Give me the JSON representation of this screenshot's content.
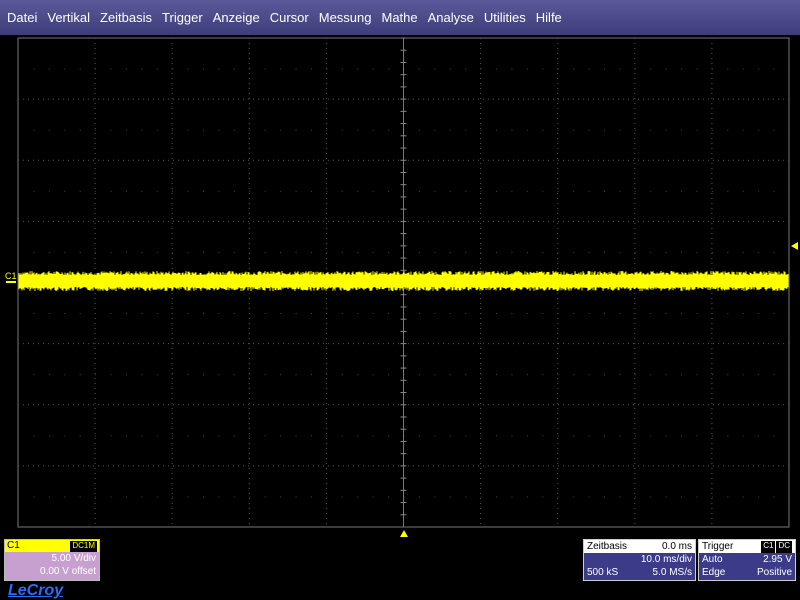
{
  "menu": [
    "Datei",
    "Vertikal",
    "Zeitbasis",
    "Trigger",
    "Anzeige",
    "Cursor",
    "Messung",
    "Mathe",
    "Analyse",
    "Utilities",
    "Hilfe"
  ],
  "trace_label": "C1",
  "channel": {
    "name": "C1",
    "coupling": "DC1M",
    "vdiv": "5.00 V/div",
    "offset": "0.00 V offset",
    "color": "#ffff00"
  },
  "timebase": {
    "title": "Zeitbasis",
    "delay": "0.0 ms",
    "tdiv": "10.0 ms/div",
    "samples": "500 kS",
    "rate": "5.0 MS/s"
  },
  "trigger": {
    "title": "Trigger",
    "source": "C1",
    "coupling": "DC",
    "mode": "Auto",
    "level": "2.95 V",
    "type": "Edge",
    "slope": "Positive"
  },
  "logo": "LeCroy"
}
